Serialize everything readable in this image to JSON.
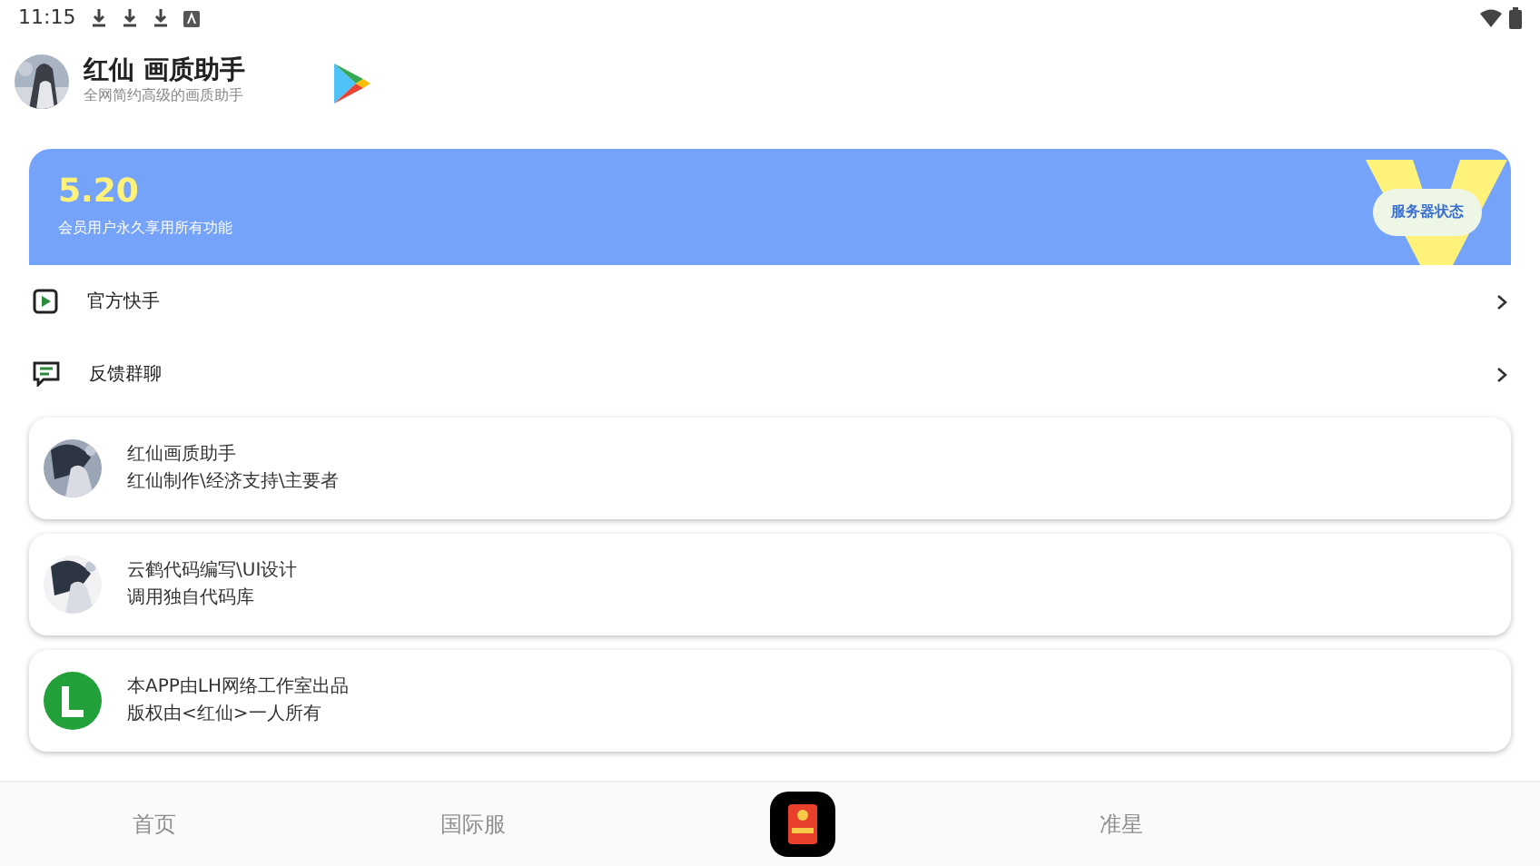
{
  "status_bar": {
    "time": "11:15"
  },
  "header": {
    "title": "红仙 画质助手",
    "subtitle": "全网简约高级的画质助手"
  },
  "banner": {
    "version": "5.20",
    "subtitle": "会员用户永久享用所有功能",
    "button": "服务器状态"
  },
  "links": [
    {
      "kind": "video",
      "label": "官方快手"
    },
    {
      "kind": "chat",
      "label": "反馈群聊"
    }
  ],
  "credits": [
    {
      "kind": "picture",
      "title": "红仙画质助手",
      "line": "红仙制作\\经济支持\\主要者"
    },
    {
      "kind": "picture",
      "title": "云鹤代码编写\\UI设计",
      "line": "调用独自代码库"
    },
    {
      "kind": "logo",
      "title": "本APP由LH网络工作室出品",
      "line": "版权由<红仙>一人所有"
    }
  ],
  "nav": [
    {
      "kind": "text",
      "label": "首页",
      "selected": false
    },
    {
      "kind": "text",
      "label": "国际服",
      "selected": false
    },
    {
      "kind": "icon",
      "selected": false
    },
    {
      "kind": "text",
      "label": "准星",
      "selected": false
    }
  ]
}
